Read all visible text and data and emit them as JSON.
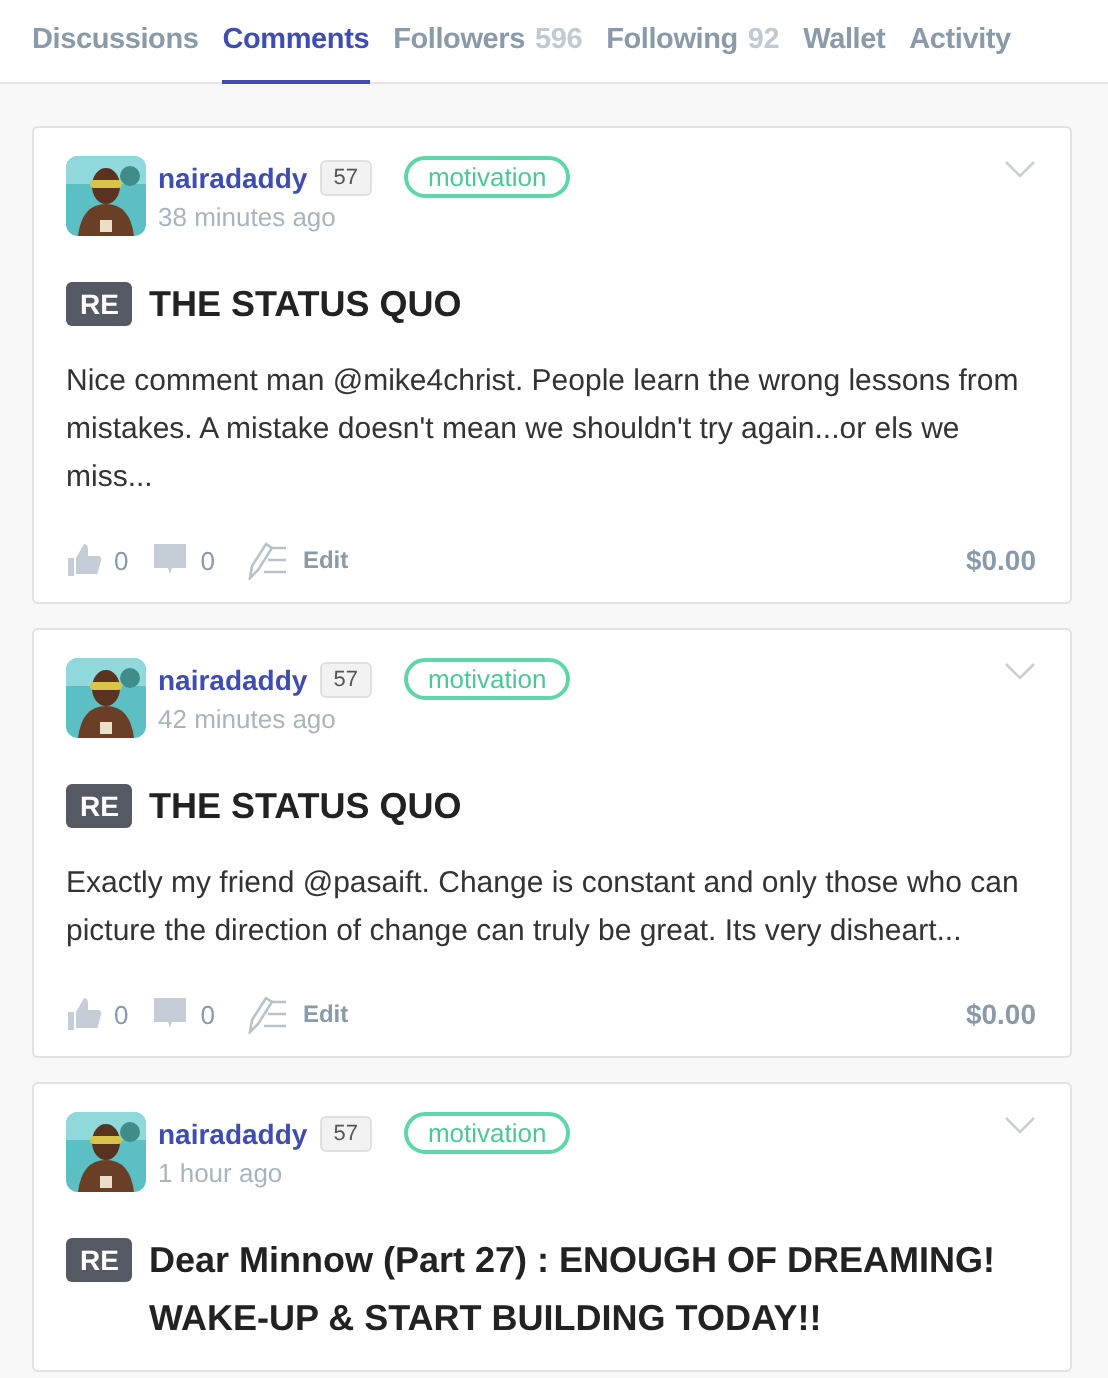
{
  "tabs": [
    {
      "label": "Discussions",
      "selected": false
    },
    {
      "label": "Comments",
      "selected": true
    },
    {
      "label": "Followers",
      "count": "596",
      "selected": false
    },
    {
      "label": "Following",
      "count": "92",
      "selected": false
    },
    {
      "label": "Wallet",
      "selected": false
    },
    {
      "label": "Activity",
      "selected": false
    }
  ],
  "comments": [
    {
      "author": "nairadaddy",
      "reputation": "57",
      "tag": "motivation",
      "time": "38 minutes ago",
      "prefix": "RE",
      "title": "THE STATUS QUO",
      "body": "Nice comment man @mike4christ. People learn the wrong lessons from mistakes. A mistake doesn't mean we shouldn't try again...or els we miss...",
      "likes": "0",
      "replies": "0",
      "edit": "Edit",
      "payout": "$0.00"
    },
    {
      "author": "nairadaddy",
      "reputation": "57",
      "tag": "motivation",
      "time": "42 minutes ago",
      "prefix": "RE",
      "title": "THE STATUS QUO",
      "body": "Exactly my friend @pasaift. Change is constant and only those who can picture the direction of change can truly be great. Its very disheart...",
      "likes": "0",
      "replies": "0",
      "edit": "Edit",
      "payout": "$0.00"
    },
    {
      "author": "nairadaddy",
      "reputation": "57",
      "tag": "motivation",
      "time": "1 hour ago",
      "prefix": "RE",
      "title": "Dear Minnow (Part 27) : ENOUGH OF DREAMING! WAKE-UP & START BUILDING TODAY!!"
    }
  ]
}
